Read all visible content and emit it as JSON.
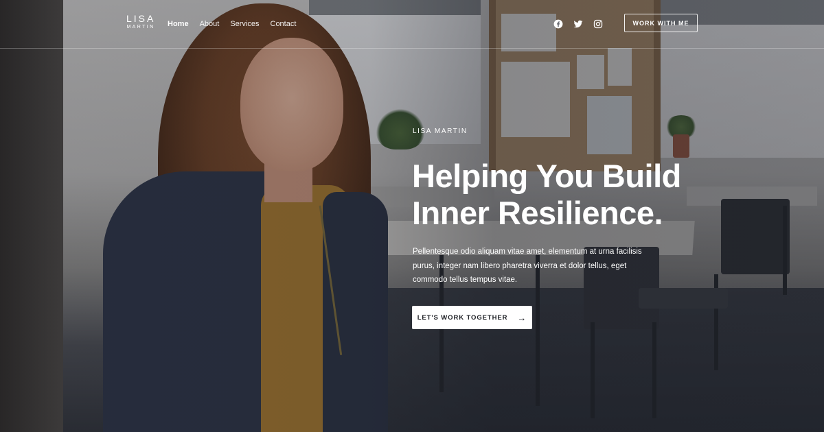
{
  "header": {
    "logo": {
      "name": "LISA",
      "sub": "MARTIN"
    },
    "nav": [
      {
        "label": "Home",
        "active": true
      },
      {
        "label": "About",
        "active": false
      },
      {
        "label": "Services",
        "active": false
      },
      {
        "label": "Contact",
        "active": false
      }
    ],
    "social_icons": [
      "facebook-icon",
      "twitter-icon",
      "instagram-icon"
    ],
    "cta_label": "WORK WITH ME"
  },
  "hero": {
    "eyebrow": "LISA MARTIN",
    "headline_line1": "Helping You Build",
    "headline_line2": "Inner Resilience.",
    "lead": "Pellentesque odio aliquam vitae amet, elementum at urna facilisis purus, integer nam libero pharetra viverra et dolor tellus, eget commodo tellus tempus vitae.",
    "cta_label": "LET'S WORK TOGETHER",
    "cta_icon": "arrow-right-icon"
  },
  "colors": {
    "text": "#ffffff",
    "button_bg": "#ffffff",
    "button_text": "#1d1f24"
  }
}
